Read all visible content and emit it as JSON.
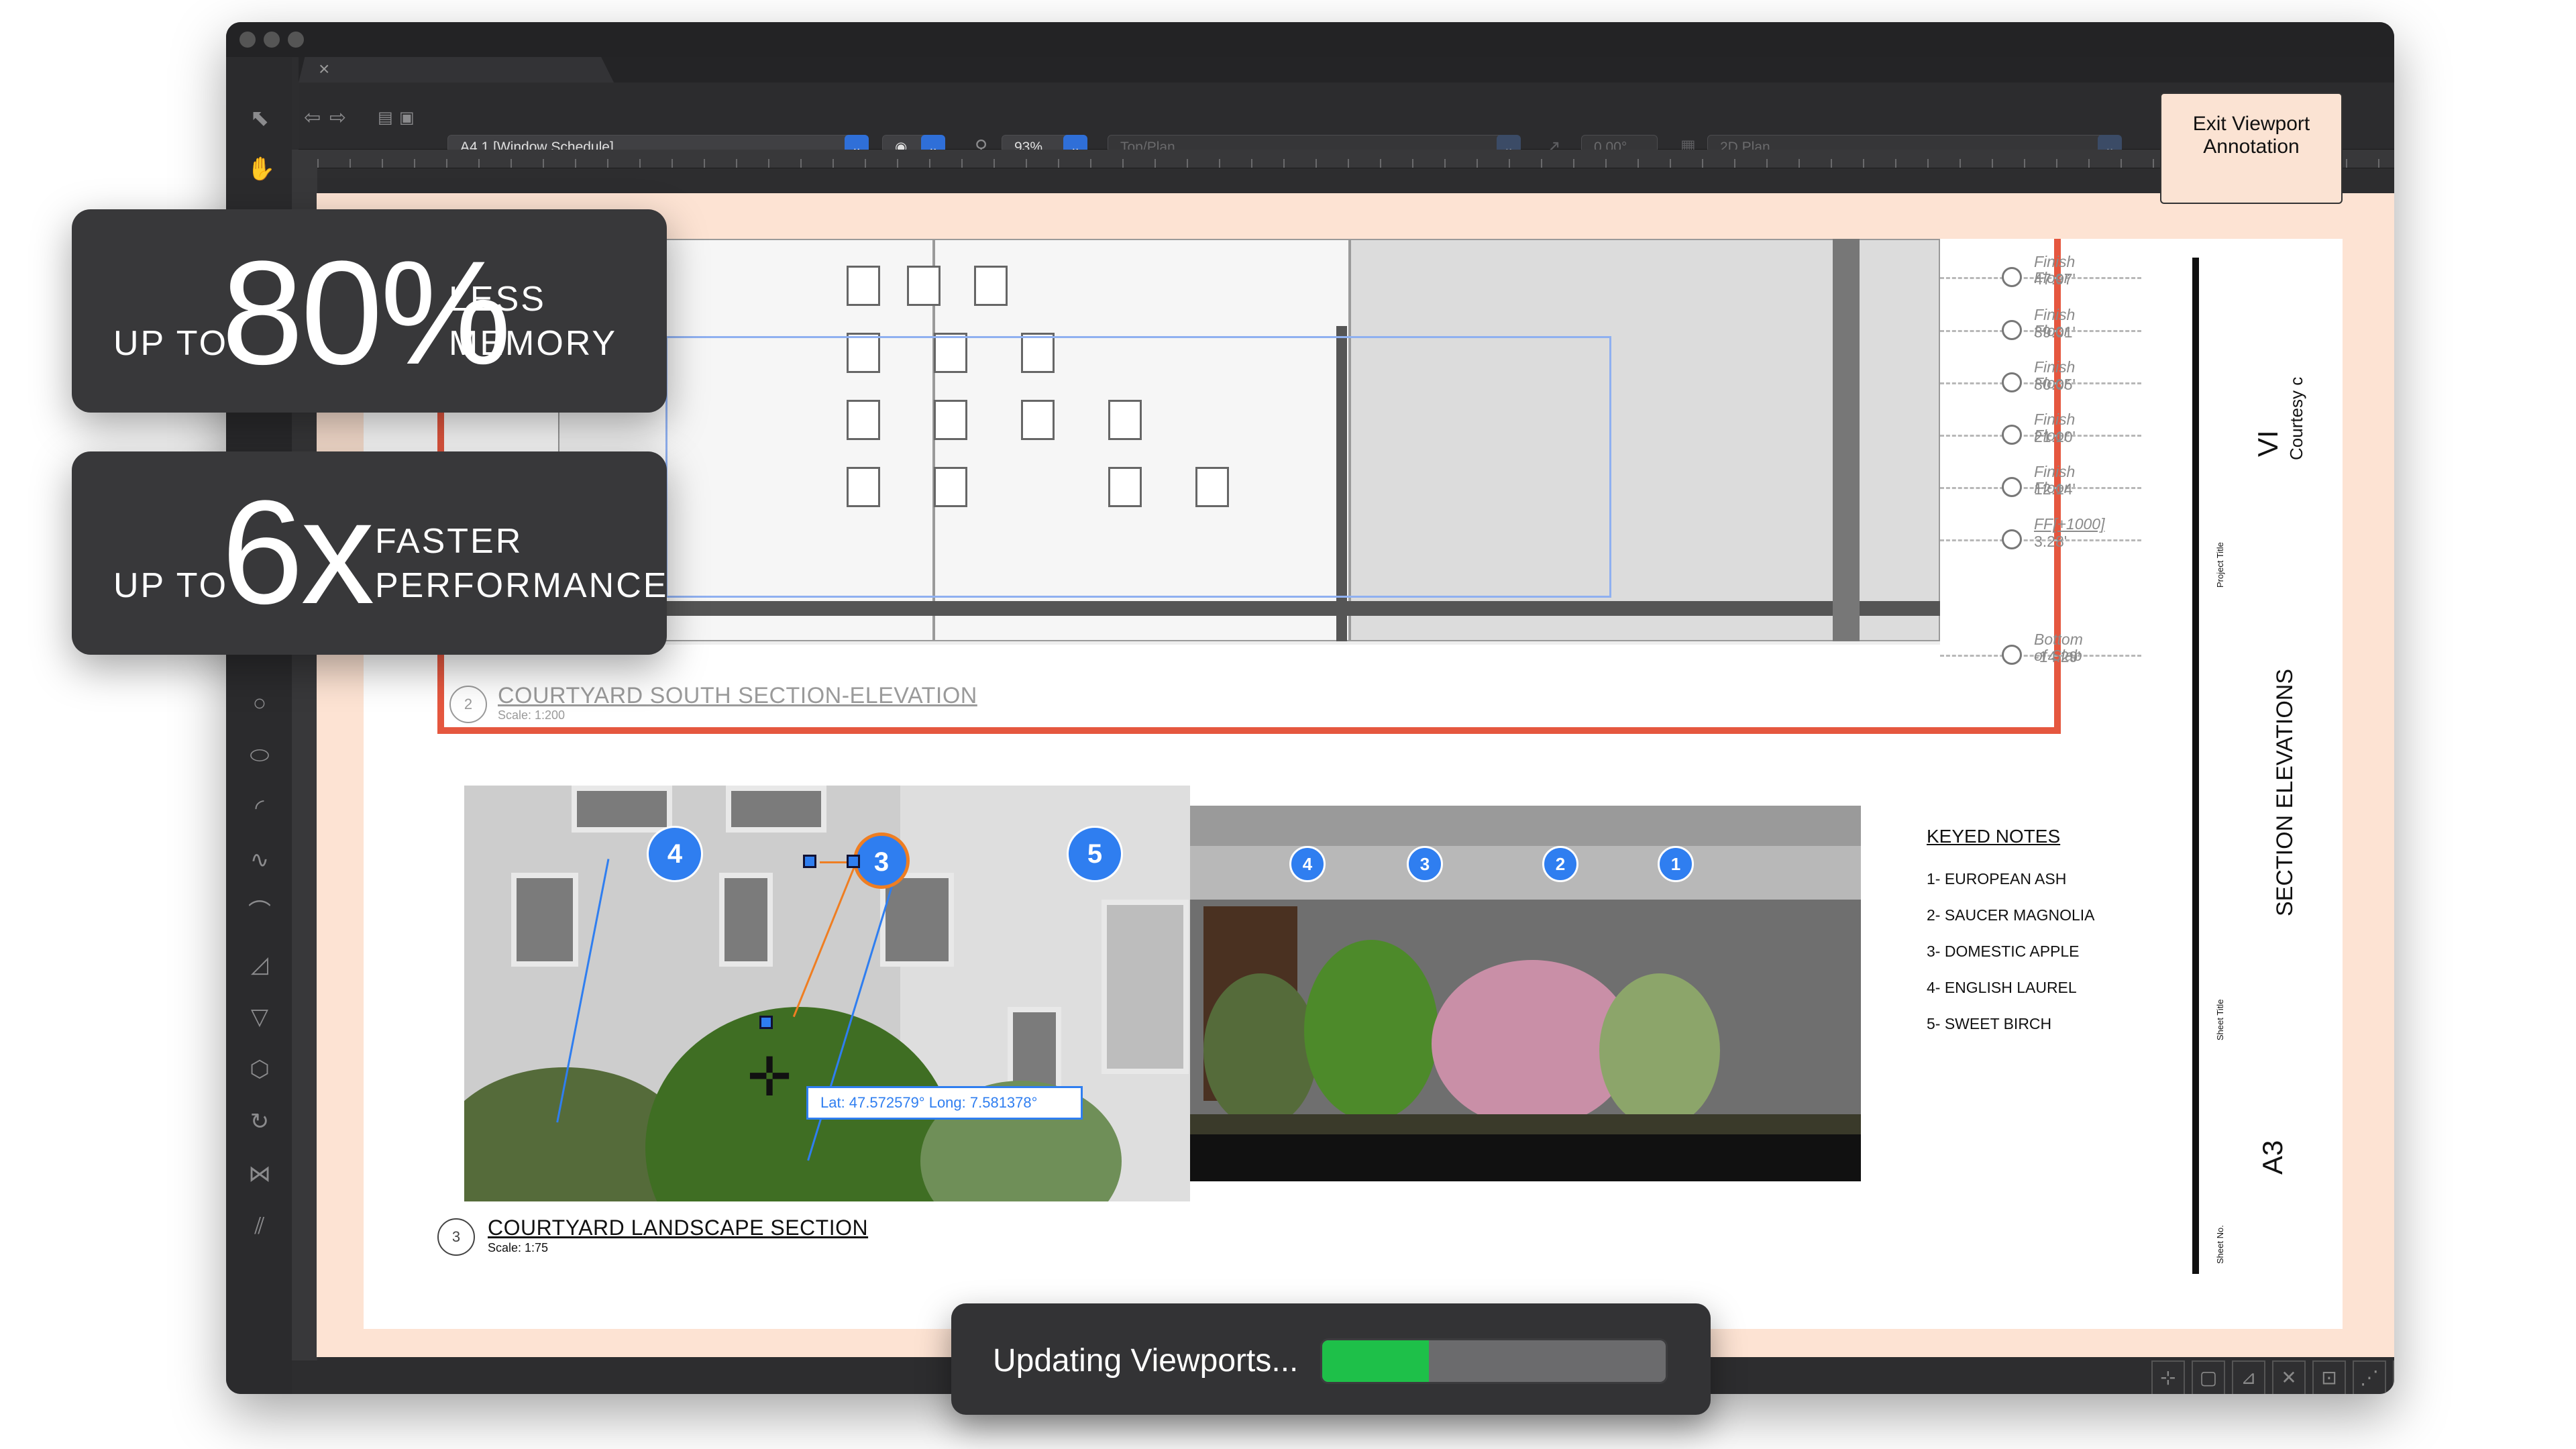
{
  "toolbar": {
    "sheet_select": "A4.1 [Window Schedule]",
    "zoom": "93%",
    "view_select": "Top/Plan",
    "rotation": "0.00°",
    "render_select": "2D Plan"
  },
  "callouts": [
    {
      "prefix": "UP TO",
      "value": "80%",
      "line1": "LESS",
      "line2": "MEMORY"
    },
    {
      "prefix": "UP TO",
      "value": "6x",
      "line1": "FASTER",
      "line2": "PERFORMANCE"
    }
  ],
  "section_south": {
    "number": "2",
    "title": "COURTYARD SOUTH SECTION-ELEVATION",
    "scale": "Scale: 1:200",
    "levels": [
      {
        "label": "Finish Floor",
        "value": "47.97'"
      },
      {
        "label": "Finish Floor",
        "value": "39.01'"
      },
      {
        "label": "Finish Floor",
        "value": "30.05'"
      },
      {
        "label": "Finish Floor",
        "value": "21.10'"
      },
      {
        "label": "Finish Floor",
        "value": "12.14'"
      },
      {
        "label": "FF[+1000]",
        "value": "3.28'"
      },
      {
        "label": "Bottom of Slab",
        "value": "-14.29'"
      }
    ]
  },
  "section_landscape": {
    "number": "3",
    "title": "COURTYARD LANDSCAPE SECTION",
    "scale": "Scale: 1:75",
    "photo_bubbles": [
      "4",
      "3",
      "5"
    ],
    "elev_bubbles": [
      "4",
      "3",
      "2",
      "1"
    ],
    "coordinate": "Lat: 47.572579°   Long: 7.581378°"
  },
  "keyed_notes": {
    "title": "KEYED NOTES",
    "items": [
      "1- EUROPEAN ASH",
      "2- SAUCER MAGNOLIA",
      "3- DOMESTIC APPLE",
      "4- ENGLISH LAUREL",
      "5- SWEET BIRCH"
    ]
  },
  "title_block": {
    "project_title_label": "Project Title",
    "project_code": "VI",
    "courtesy": "Courtesy c",
    "sheet_title_label": "Sheet Title",
    "sheet_title": "SECTION ELEVATIONS",
    "sheet_no_label": "Sheet No.",
    "sheet_no": "A3"
  },
  "exit_button": "Exit Viewport Annotation",
  "progress": {
    "label": "Updating Viewports...",
    "fraction": 0.31
  },
  "colors": {
    "accent": "#2f7ef0",
    "progress": "#1ec049",
    "section_border": "#e5573f",
    "sheet_bg": "#fde3d3"
  }
}
